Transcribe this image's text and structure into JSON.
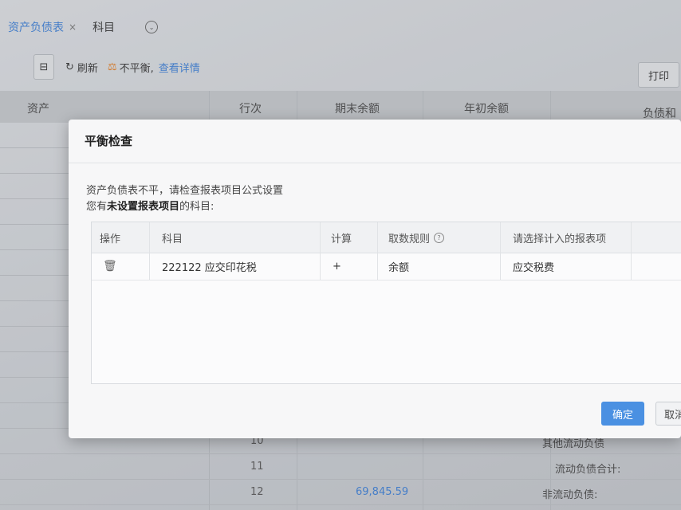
{
  "tabs": [
    {
      "label": "资产负债表",
      "close": "×",
      "active": true
    },
    {
      "label": "科目",
      "active": false
    }
  ],
  "toolbar": {
    "refresh_label": "刷新",
    "warning_label": "不平衡,",
    "detail_link": "查看详情",
    "print_label": "打印"
  },
  "table_header": {
    "asset": "资产",
    "row_no": "行次",
    "end_balance": "期末余额",
    "start_balance": "年初余额",
    "liabilities": "负债和所"
  },
  "bg_rows": [
    {
      "num": "10",
      "value": "",
      "right": "其他流动负债"
    },
    {
      "num": "11",
      "value": "",
      "right": "流动负债合计:"
    },
    {
      "num": "12",
      "value": "69,845.59",
      "right": "非流动负债:"
    }
  ],
  "modal": {
    "title": "平衡检查",
    "message_line1": "资产负债表不平，请检查报表项目公式设置",
    "message_line2_prefix": "您有",
    "message_line2_bold": "未设置报表项目",
    "message_line2_suffix": "的科目:",
    "columns": {
      "op": "操作",
      "account": "科目",
      "calc": "计算",
      "rule": "取数规则",
      "target": "请选择计入的报表项"
    },
    "rows": [
      {
        "account": "222122 应交印花税",
        "calc": "+",
        "rule": "余额",
        "target": "应交税费"
      }
    ],
    "ok_label": "确定",
    "cancel_label": "取消"
  },
  "colors": {
    "accent": "#4a90e2",
    "link": "#3b7fd8",
    "warning": "#e67e22"
  }
}
